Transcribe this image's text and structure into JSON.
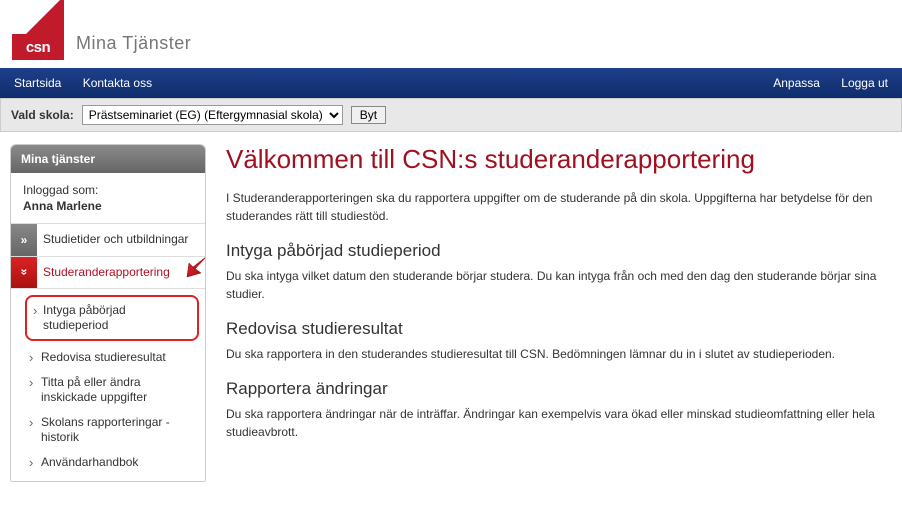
{
  "brand": {
    "logo_text": "csn",
    "site_title": "Mina Tjänster"
  },
  "topnav": {
    "left": [
      {
        "label": "Startsida"
      },
      {
        "label": "Kontakta oss"
      }
    ],
    "right": [
      {
        "label": "Anpassa"
      },
      {
        "label": "Logga ut"
      }
    ]
  },
  "schoolbar": {
    "label": "Vald skola:",
    "selected": "Prästseminariet (EG) (Eftergymnasial skola)",
    "button": "Byt"
  },
  "sidebar": {
    "header": "Mina tjänster",
    "logged_in_label": "Inloggad som:",
    "user_name": "Anna Marlene",
    "items": [
      {
        "label": "Studietider och utbildningar",
        "expanded": false
      },
      {
        "label": "Studeranderapportering",
        "expanded": true
      }
    ],
    "submenu": [
      {
        "label": "Intyga påbörjad studieperiod",
        "highlighted": true
      },
      {
        "label": "Redovisa studieresultat"
      },
      {
        "label": "Titta på eller ändra inskickade uppgifter"
      },
      {
        "label": "Skolans rapporteringar - historik"
      },
      {
        "label": "Användarhandbok"
      }
    ]
  },
  "main": {
    "h1": "Välkommen till CSN:s studeranderapportering",
    "intro": "I Studeranderapporteringen ska du rapportera uppgifter om de studerande på din skola. Uppgifterna har betydelse för den studerandes rätt till studiestöd.",
    "sections": [
      {
        "heading": "Intyga påbörjad studieperiod",
        "body": "Du ska intyga vilket datum den studerande börjar studera. Du kan intyga från och med den dag den studerande börjar sina studier."
      },
      {
        "heading": "Redovisa studieresultat",
        "body": "Du ska rapportera in den studerandes studieresultat till CSN. Bedömningen lämnar du in i slutet av studieperioden."
      },
      {
        "heading": "Rapportera ändringar",
        "body": "Du ska rapportera ändringar när de inträffar. Ändringar kan exempelvis vara ökad eller minskad studieomfattning eller hela studieavbrott."
      }
    ]
  }
}
